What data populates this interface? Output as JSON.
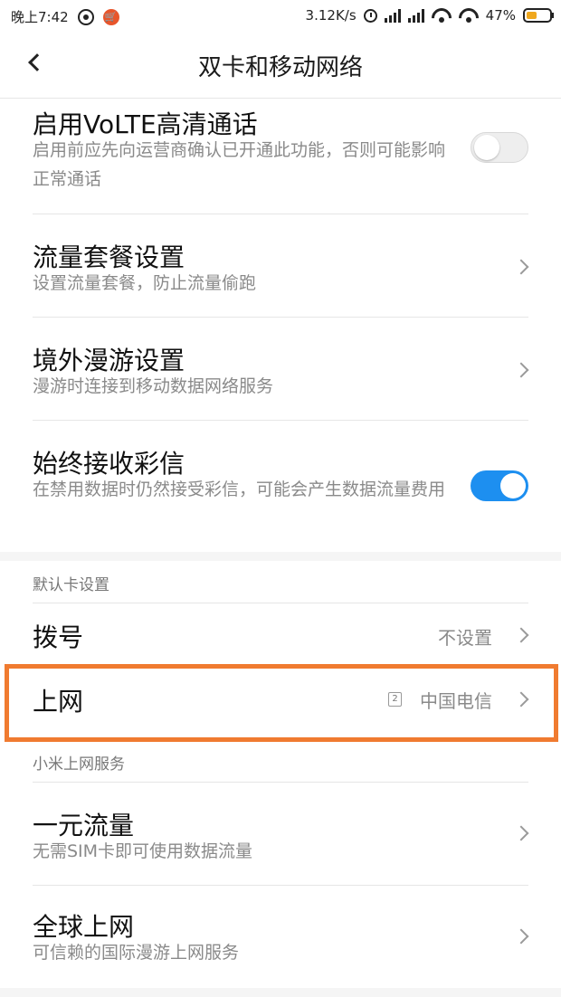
{
  "status_bar": {
    "time": "晚上7:42",
    "speed": "3.12K/s",
    "battery": "47%",
    "battery_level": 0.47,
    "icons": [
      "weibo-icon",
      "shop-icon",
      "alarm-icon",
      "signal-icon",
      "signal-icon",
      "wifi-icon",
      "wifi-icon",
      "battery-icon"
    ]
  },
  "nav": {
    "title": "双卡和移动网络",
    "back_icon": "chevron-left-icon"
  },
  "settings": {
    "volte": {
      "title": "启用VoLTE高清通话",
      "subtitle": "启用前应先向运营商确认已开通此功能，否则可能影响正常通话",
      "enabled": false
    },
    "data_plan": {
      "title": "流量套餐设置",
      "subtitle": "设置流量套餐，防止流量偷跑"
    },
    "roaming": {
      "title": "境外漫游设置",
      "subtitle": "漫游时连接到移动数据网络服务"
    },
    "mms": {
      "title": "始终接收彩信",
      "subtitle": "在禁用数据时仍然接受彩信，可能会产生数据流量费用",
      "enabled": true
    }
  },
  "default_sim": {
    "header": "默认卡设置",
    "dial": {
      "title": "拨号",
      "value": "不设置"
    },
    "internet": {
      "title": "上网",
      "sim_badge": "2",
      "value": "中国电信"
    }
  },
  "mi_services": {
    "header": "小米上网服务",
    "one_yuan": {
      "title": "一元流量",
      "subtitle": "无需SIM卡即可使用数据流量"
    },
    "global": {
      "title": "全球上网",
      "subtitle": "可信赖的国际漫游上网服务"
    }
  },
  "colors": {
    "accent": "#1d8ff0",
    "highlight": "#f07b30",
    "battery": "#f0a81e"
  }
}
